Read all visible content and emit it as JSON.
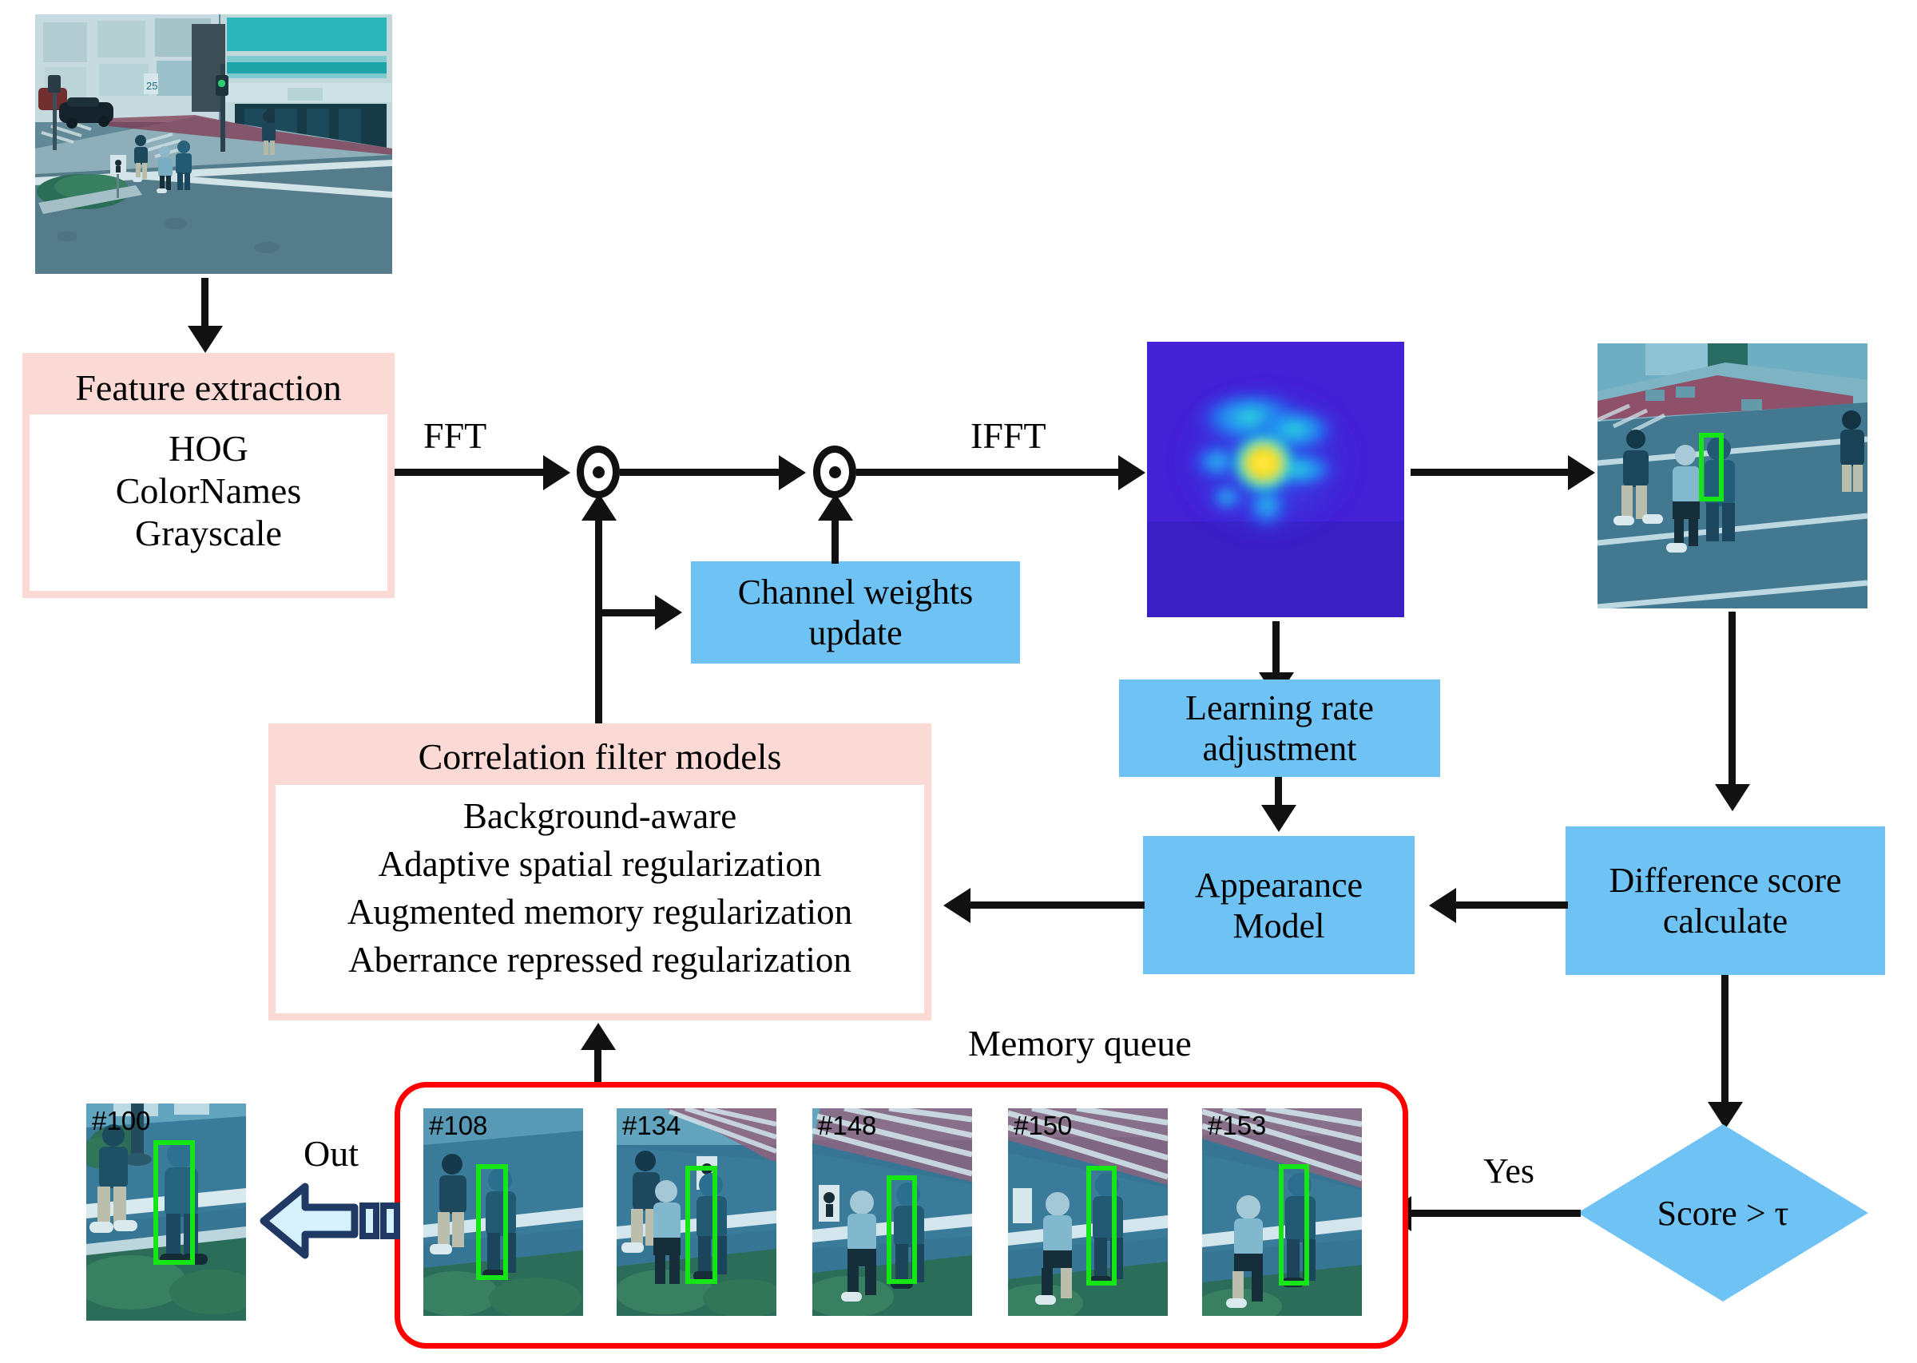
{
  "diagram": {
    "title_hidden": "",
    "colors": {
      "pink_fill": "#fbd9d4",
      "blue_fill": "#6ec3f4",
      "memory_queue_border": "#ff0000",
      "bbox_green": "#16e616",
      "arrow_black": "#111111",
      "out_arrow_outline": "#1f3864",
      "out_arrow_fill": "#d6f1fb"
    }
  },
  "input_frame": {
    "name": "input-video-frame"
  },
  "feature_extraction": {
    "header": "Feature extraction",
    "items": [
      "HOG",
      "ColorNames",
      "Grayscale"
    ]
  },
  "correlation_filter": {
    "header": "Correlation filter models",
    "items": [
      "Background-aware",
      "Adaptive spatial regularization",
      "Augmented memory regularization",
      "Aberrance repressed regularization"
    ]
  },
  "edge_labels": {
    "fft": "FFT",
    "ifft": "IFFT",
    "yes": "Yes",
    "out": "Out",
    "memory_queue": "Memory queue"
  },
  "operators": {
    "hadamard_1": "⊙",
    "hadamard_2": "⊙"
  },
  "blocks": {
    "channel_weights_update": "Channel weights\nupdate",
    "channel_weights_update_l1": "Channel weights",
    "channel_weights_update_l2": "update",
    "learning_rate_l1": "Learning rate",
    "learning_rate_l2": "adjustment",
    "appearance_l1": "Appearance",
    "appearance_l2": "Model",
    "difference_l1": "Difference score",
    "difference_l2": "calculate"
  },
  "decision": {
    "label": "Score > τ"
  },
  "response_map": {
    "name": "correlation-response-heatmap"
  },
  "tracking_result": {
    "name": "tracking-result-frame"
  },
  "output_frame": {
    "number": "#100"
  },
  "memory_queue": {
    "frames": [
      {
        "number": "#108"
      },
      {
        "number": "#134"
      },
      {
        "number": "#148"
      },
      {
        "number": "#150"
      },
      {
        "number": "#153"
      }
    ]
  }
}
